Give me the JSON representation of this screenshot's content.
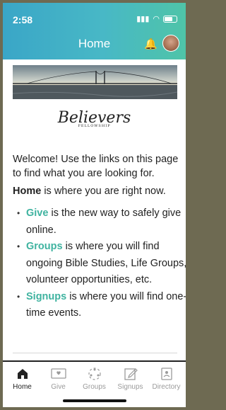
{
  "status_bar": {
    "time": "2:58"
  },
  "header": {
    "title": "Home"
  },
  "logo": {
    "script_text": "Believers",
    "sub_text": "FELLOWSHIP"
  },
  "content": {
    "welcome": "Welcome! Use the links on this page to find what you are looking for.",
    "home_bold": "Home",
    "home_rest": " is where you are right now.",
    "items": [
      {
        "link": "Give",
        "text": " is the new way to safely give online."
      },
      {
        "link": "Groups",
        "text": " is where you will find ongoing Bible Studies, Life Groups, volunteer opportunities, etc."
      },
      {
        "link": "Signups",
        "text": " is where you will find one-time events."
      }
    ]
  },
  "tabs": [
    {
      "label": "Home",
      "icon": "home-icon"
    },
    {
      "label": "Give",
      "icon": "give-icon"
    },
    {
      "label": "Groups",
      "icon": "groups-icon"
    },
    {
      "label": "Signups",
      "icon": "signups-icon"
    },
    {
      "label": "Directory",
      "icon": "directory-icon"
    }
  ],
  "colors": {
    "accent": "#3fb3a0",
    "header_start": "#3aa6c7",
    "header_end": "#4fc4a8"
  }
}
